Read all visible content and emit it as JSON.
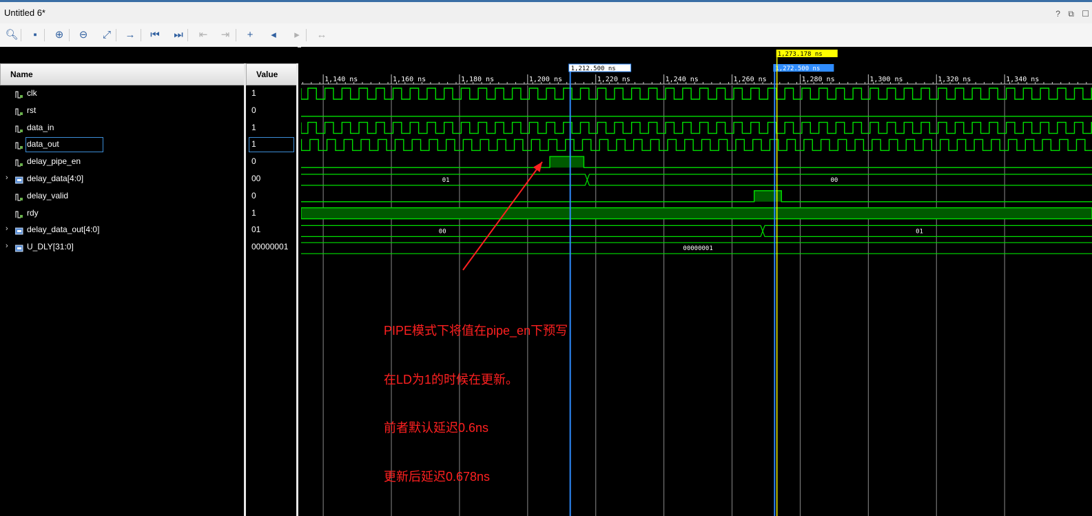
{
  "window": {
    "title": "Untitled 6*",
    "controls": [
      "?",
      "⧉",
      "☐"
    ]
  },
  "toolbar": {
    "buttons": [
      {
        "name": "search-icon",
        "glyph": "🔍︎"
      },
      {
        "name": "save-icon",
        "glyph": "▪"
      },
      {
        "name": "zoom-in-icon",
        "glyph": "⊕"
      },
      {
        "name": "zoom-out-icon",
        "glyph": "⊖"
      },
      {
        "name": "zoom-fit-icon",
        "glyph": "⤢"
      },
      {
        "name": "goto-cursor-icon",
        "glyph": "→"
      },
      {
        "name": "goto-start-icon",
        "glyph": "⏮"
      },
      {
        "name": "goto-end-icon",
        "glyph": "⏭"
      },
      {
        "name": "prev-transition-icon",
        "glyph": "⇤"
      },
      {
        "name": "next-transition-icon",
        "glyph": "⇥"
      },
      {
        "name": "add-marker-icon",
        "glyph": "+"
      },
      {
        "name": "prev-marker-icon",
        "glyph": "◂"
      },
      {
        "name": "next-marker-icon",
        "glyph": "▸"
      },
      {
        "name": "swap-cursors-icon",
        "glyph": "↔"
      }
    ]
  },
  "headers": {
    "name": "Name",
    "value": "Value"
  },
  "signals": [
    {
      "name": "clk",
      "value": "1",
      "type": "bit",
      "expandable": false
    },
    {
      "name": "rst",
      "value": "0",
      "type": "bit",
      "expandable": false
    },
    {
      "name": "data_in",
      "value": "1",
      "type": "bit",
      "expandable": false
    },
    {
      "name": "data_out",
      "value": "1",
      "type": "bit",
      "expandable": false,
      "selected": true
    },
    {
      "name": "delay_pipe_en",
      "value": "0",
      "type": "bit",
      "expandable": false
    },
    {
      "name": "delay_data[4:0]",
      "value": "00",
      "type": "bus",
      "expandable": true
    },
    {
      "name": "delay_valid",
      "value": "0",
      "type": "bit",
      "expandable": false
    },
    {
      "name": "rdy",
      "value": "1",
      "type": "bit",
      "expandable": false
    },
    {
      "name": "delay_data_out[4:0]",
      "value": "01",
      "type": "bus",
      "expandable": true
    },
    {
      "name": "U_DLY[31:0]",
      "value": "00000001",
      "type": "bus",
      "expandable": true
    }
  ],
  "waves": {
    "time_unit": "ns",
    "ticks": [
      "1,140 ns",
      "1,160 ns",
      "1,180 ns",
      "1,200 ns",
      "1,220 ns",
      "1,240 ns",
      "1,260 ns",
      "1,280 ns",
      "1,300 ns",
      "1,320 ns",
      "1,340 ns"
    ],
    "tick_values": [
      1140,
      1160,
      1180,
      1200,
      1220,
      1240,
      1260,
      1280,
      1300,
      1320,
      1340
    ],
    "markers": [
      {
        "label": "1,212.500 ns",
        "time": 1212.5,
        "style": "white"
      },
      {
        "label": "1,272.500 ns",
        "time": 1272.5,
        "style": "blue"
      },
      {
        "label": "1,273.178 ns",
        "time": 1273.178,
        "style": "yellow"
      }
    ],
    "clock_period_ns": 5,
    "bus_labels": {
      "delay_data": [
        {
          "text": "01",
          "time": 1176
        },
        {
          "text": "00",
          "time": 1290
        }
      ],
      "delay_data_out": [
        {
          "text": "00",
          "time": 1175
        },
        {
          "text": "01",
          "time": 1315
        }
      ],
      "U_DLY": [
        {
          "text": "00000001",
          "time": 1250
        }
      ]
    },
    "pulses": {
      "delay_pipe_en": [
        1206.5,
        1216.5
      ],
      "delay_valid": [
        1266.5,
        1274.5
      ]
    },
    "transitions": {
      "delay_data": 1217.5,
      "delay_data_out": 1269
    }
  },
  "annotation": {
    "lines": [
      "PIPE模式下将值在pipe_en下预写",
      "在LD为1的时候在更新。",
      "前者默认延迟0.6ns",
      "更新后延迟0.678ns"
    ],
    "color": "#ff2020"
  },
  "colors": {
    "wave": "#00e000",
    "wave_fill": "#005a00",
    "marker_blue": "#2f8cff",
    "marker_yellow": "#ffff00"
  }
}
